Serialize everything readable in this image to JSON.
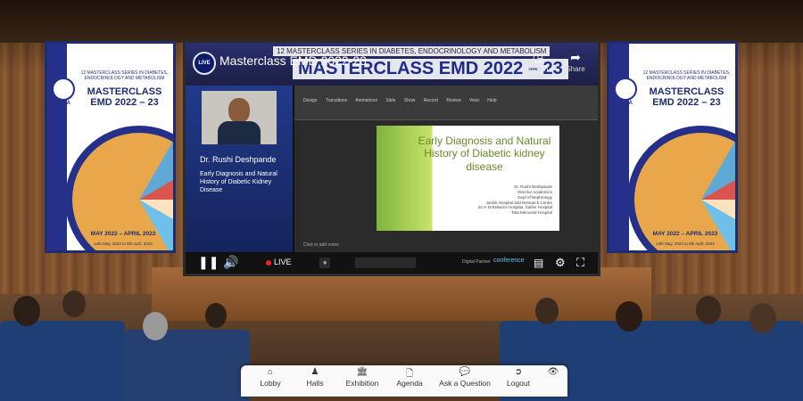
{
  "screen": {
    "live_badge": "LIVE",
    "video_title": "Masterclass EMD 2022-23",
    "series_line": "12 MASTERCLASS SERIES IN DIABETES, ENDOCRINOLOGY AND METABOLISM",
    "big_title": "MASTERCLASS EMD 2022 – 23",
    "watch_later": "Watch Later",
    "share": "Share",
    "speaker_name": "Dr. Rushi Deshpande",
    "talk_title": "Early Diagnosis and Natural History of Diabetic Kidney Disease",
    "slide_title": "Early Diagnosis and Natural History of Diabetic kidney disease",
    "slide_meta": "Dr. Rushi Deshpande\nDirector Academics\nDept of Nephrology\nJaslok Hospital and Research Centre\nSir H N Reliance Hospital, Saifee Hospital\nTata Memorial Hospital",
    "ppt_tabs": "Design Transitions Animations Slide Show Record Review View Help",
    "ppt_note": "Click to add notes",
    "live_label": "LIVE",
    "partner_label": "Digital Partner",
    "partner_name": "conference"
  },
  "banners": {
    "series": "12 MASTERCLASS SERIES IN DIABETES, ENDOCRINOLOGY AND METABOLISM",
    "title": "MASTERCLASS EMD 2022 – 23",
    "logo_text": "DENMA",
    "dates": "MAY 2022 – APRIL 2023",
    "dates_sub": "14th May, 2022 to 8th April, 2023"
  },
  "nav": {
    "items": [
      {
        "label": "Lobby",
        "icon": "home-icon"
      },
      {
        "label": "Halls",
        "icon": "person-icon"
      },
      {
        "label": "Exhibition",
        "icon": "building-icon"
      },
      {
        "label": "Agenda",
        "icon": "document-icon"
      },
      {
        "label": "Ask a Question",
        "icon": "chat-icon"
      },
      {
        "label": "Logout",
        "icon": "logout-icon"
      }
    ]
  },
  "colors": {
    "brand_navy": "#1f2d6e",
    "live_red": "#e22222",
    "slide_green": "#7fb43c"
  }
}
